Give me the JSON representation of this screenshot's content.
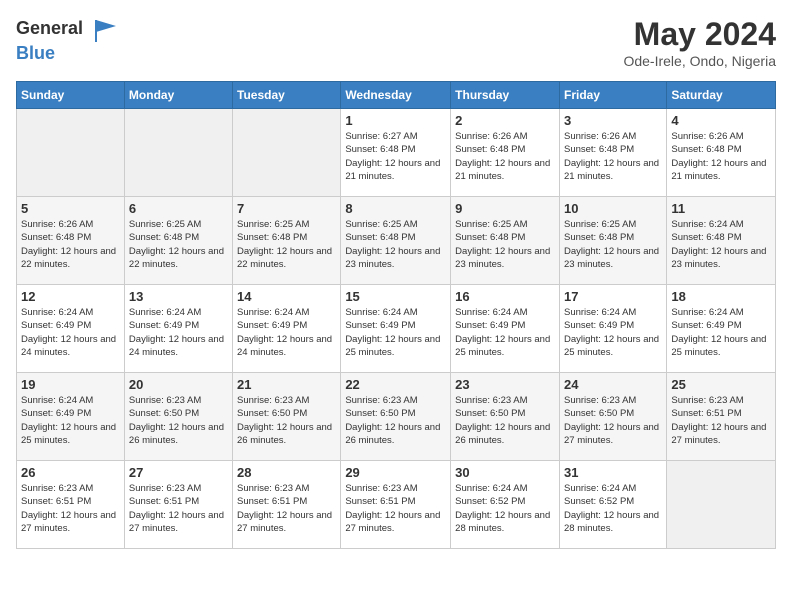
{
  "header": {
    "logo_general": "General",
    "logo_blue": "Blue",
    "month_year": "May 2024",
    "location": "Ode-Irele, Ondo, Nigeria"
  },
  "weekdays": [
    "Sunday",
    "Monday",
    "Tuesday",
    "Wednesday",
    "Thursday",
    "Friday",
    "Saturday"
  ],
  "weeks": [
    [
      {
        "day": "",
        "info": ""
      },
      {
        "day": "",
        "info": ""
      },
      {
        "day": "",
        "info": ""
      },
      {
        "day": "1",
        "info": "Sunrise: 6:27 AM\nSunset: 6:48 PM\nDaylight: 12 hours and 21 minutes."
      },
      {
        "day": "2",
        "info": "Sunrise: 6:26 AM\nSunset: 6:48 PM\nDaylight: 12 hours and 21 minutes."
      },
      {
        "day": "3",
        "info": "Sunrise: 6:26 AM\nSunset: 6:48 PM\nDaylight: 12 hours and 21 minutes."
      },
      {
        "day": "4",
        "info": "Sunrise: 6:26 AM\nSunset: 6:48 PM\nDaylight: 12 hours and 21 minutes."
      }
    ],
    [
      {
        "day": "5",
        "info": "Sunrise: 6:26 AM\nSunset: 6:48 PM\nDaylight: 12 hours and 22 minutes."
      },
      {
        "day": "6",
        "info": "Sunrise: 6:25 AM\nSunset: 6:48 PM\nDaylight: 12 hours and 22 minutes."
      },
      {
        "day": "7",
        "info": "Sunrise: 6:25 AM\nSunset: 6:48 PM\nDaylight: 12 hours and 22 minutes."
      },
      {
        "day": "8",
        "info": "Sunrise: 6:25 AM\nSunset: 6:48 PM\nDaylight: 12 hours and 23 minutes."
      },
      {
        "day": "9",
        "info": "Sunrise: 6:25 AM\nSunset: 6:48 PM\nDaylight: 12 hours and 23 minutes."
      },
      {
        "day": "10",
        "info": "Sunrise: 6:25 AM\nSunset: 6:48 PM\nDaylight: 12 hours and 23 minutes."
      },
      {
        "day": "11",
        "info": "Sunrise: 6:24 AM\nSunset: 6:48 PM\nDaylight: 12 hours and 23 minutes."
      }
    ],
    [
      {
        "day": "12",
        "info": "Sunrise: 6:24 AM\nSunset: 6:49 PM\nDaylight: 12 hours and 24 minutes."
      },
      {
        "day": "13",
        "info": "Sunrise: 6:24 AM\nSunset: 6:49 PM\nDaylight: 12 hours and 24 minutes."
      },
      {
        "day": "14",
        "info": "Sunrise: 6:24 AM\nSunset: 6:49 PM\nDaylight: 12 hours and 24 minutes."
      },
      {
        "day": "15",
        "info": "Sunrise: 6:24 AM\nSunset: 6:49 PM\nDaylight: 12 hours and 25 minutes."
      },
      {
        "day": "16",
        "info": "Sunrise: 6:24 AM\nSunset: 6:49 PM\nDaylight: 12 hours and 25 minutes."
      },
      {
        "day": "17",
        "info": "Sunrise: 6:24 AM\nSunset: 6:49 PM\nDaylight: 12 hours and 25 minutes."
      },
      {
        "day": "18",
        "info": "Sunrise: 6:24 AM\nSunset: 6:49 PM\nDaylight: 12 hours and 25 minutes."
      }
    ],
    [
      {
        "day": "19",
        "info": "Sunrise: 6:24 AM\nSunset: 6:49 PM\nDaylight: 12 hours and 25 minutes."
      },
      {
        "day": "20",
        "info": "Sunrise: 6:23 AM\nSunset: 6:50 PM\nDaylight: 12 hours and 26 minutes."
      },
      {
        "day": "21",
        "info": "Sunrise: 6:23 AM\nSunset: 6:50 PM\nDaylight: 12 hours and 26 minutes."
      },
      {
        "day": "22",
        "info": "Sunrise: 6:23 AM\nSunset: 6:50 PM\nDaylight: 12 hours and 26 minutes."
      },
      {
        "day": "23",
        "info": "Sunrise: 6:23 AM\nSunset: 6:50 PM\nDaylight: 12 hours and 26 minutes."
      },
      {
        "day": "24",
        "info": "Sunrise: 6:23 AM\nSunset: 6:50 PM\nDaylight: 12 hours and 27 minutes."
      },
      {
        "day": "25",
        "info": "Sunrise: 6:23 AM\nSunset: 6:51 PM\nDaylight: 12 hours and 27 minutes."
      }
    ],
    [
      {
        "day": "26",
        "info": "Sunrise: 6:23 AM\nSunset: 6:51 PM\nDaylight: 12 hours and 27 minutes."
      },
      {
        "day": "27",
        "info": "Sunrise: 6:23 AM\nSunset: 6:51 PM\nDaylight: 12 hours and 27 minutes."
      },
      {
        "day": "28",
        "info": "Sunrise: 6:23 AM\nSunset: 6:51 PM\nDaylight: 12 hours and 27 minutes."
      },
      {
        "day": "29",
        "info": "Sunrise: 6:23 AM\nSunset: 6:51 PM\nDaylight: 12 hours and 27 minutes."
      },
      {
        "day": "30",
        "info": "Sunrise: 6:24 AM\nSunset: 6:52 PM\nDaylight: 12 hours and 28 minutes."
      },
      {
        "day": "31",
        "info": "Sunrise: 6:24 AM\nSunset: 6:52 PM\nDaylight: 12 hours and 28 minutes."
      },
      {
        "day": "",
        "info": ""
      }
    ]
  ]
}
